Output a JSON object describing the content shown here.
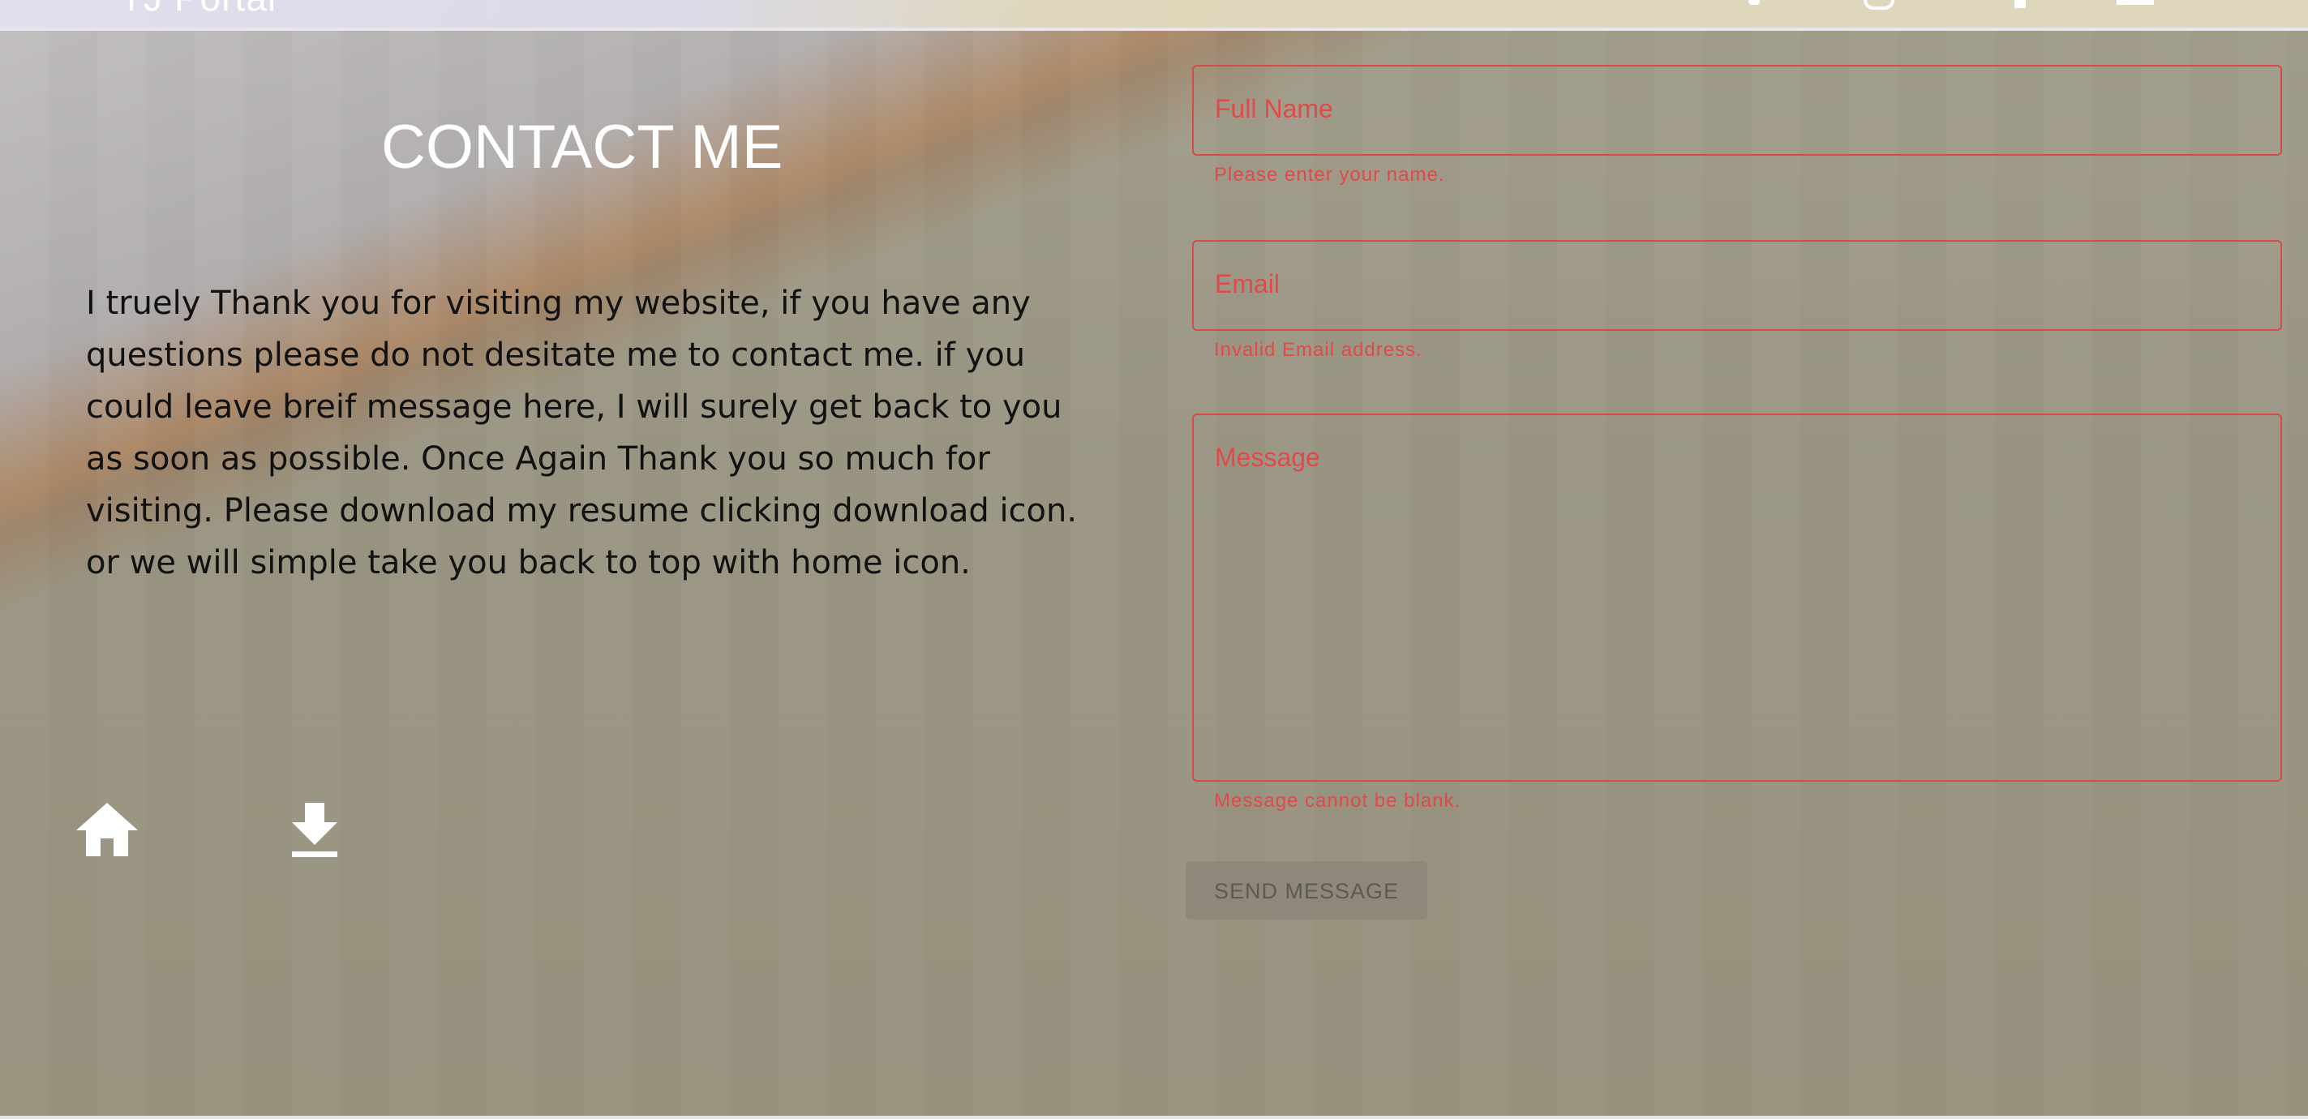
{
  "header": {
    "brand": "TJ Portal",
    "nav_icons": [
      "facebook-icon",
      "at-icon",
      "linkedin-icon",
      "menu-icon"
    ]
  },
  "contact": {
    "title": "CONTACT ME",
    "body": "I truely Thank you for visiting my website, if you have any questions please do not desitate me to contact me. if you could leave breif message here, I will surely get back to you as soon as possible. Once Again Thank you so much for visiting. Please download my resume clicking download icon. or we will simple take you back to top with home icon.",
    "icons": {
      "home": "home-icon",
      "download": "download-icon"
    }
  },
  "form": {
    "name": {
      "placeholder": "Full Name",
      "error": "Please enter your name."
    },
    "email": {
      "placeholder": "Email",
      "error": "Invalid Email address."
    },
    "message": {
      "placeholder": "Message",
      "error": "Message cannot be blank."
    },
    "submit_label": "SEND MESSAGE"
  },
  "colors": {
    "error": "#e04a4a",
    "overlay": "#9b9583",
    "title": "#ffffff",
    "body_text": "#111111"
  }
}
